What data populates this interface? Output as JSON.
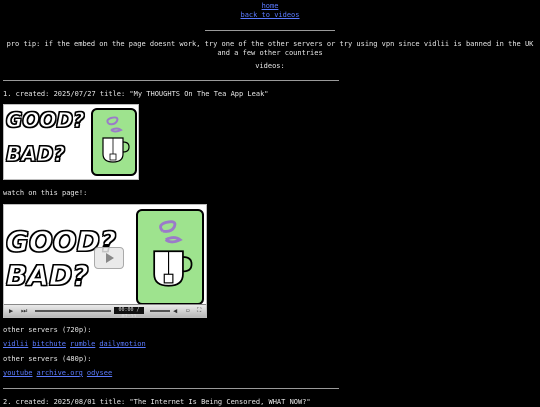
{
  "nav": {
    "home": "home",
    "back": "back to videos"
  },
  "tip": "pro tip: if the embed on the page doesnt work, try one of the other servers or try using vpn since vidlii is banned in the UK and a few other countries",
  "videos_label": "videos:",
  "videos": [
    {
      "title": "1. created: 2025/07/27 title: \"My THOUGHTS On The Tea App Leak\"",
      "thumb_text_top": "GOOD?",
      "thumb_text_bottom": "BAD?",
      "watch_label": "watch on this page!:",
      "player_time": "00:00 / 07:11",
      "servers_720_label": "other servers (720p):",
      "servers_720": [
        "vidlii",
        "bitchute",
        "rumble",
        "dailymotion"
      ],
      "servers_480_label": "other servers (480p):",
      "servers_480": [
        "youtube",
        "archive.org",
        "odysee"
      ]
    },
    {
      "title": "2. created: 2025/08/01 title: \"The Internet Is Being Censored, WHAT NOW?\""
    }
  ],
  "colors": {
    "background": "#000000",
    "text": "#e8e8e8",
    "link": "#5b7bff",
    "thumb_green": "#9ee38e"
  },
  "icons": [
    "play-icon",
    "skip-icon",
    "volume-icon",
    "fullscreen-icon",
    "tea-cup-icon"
  ]
}
